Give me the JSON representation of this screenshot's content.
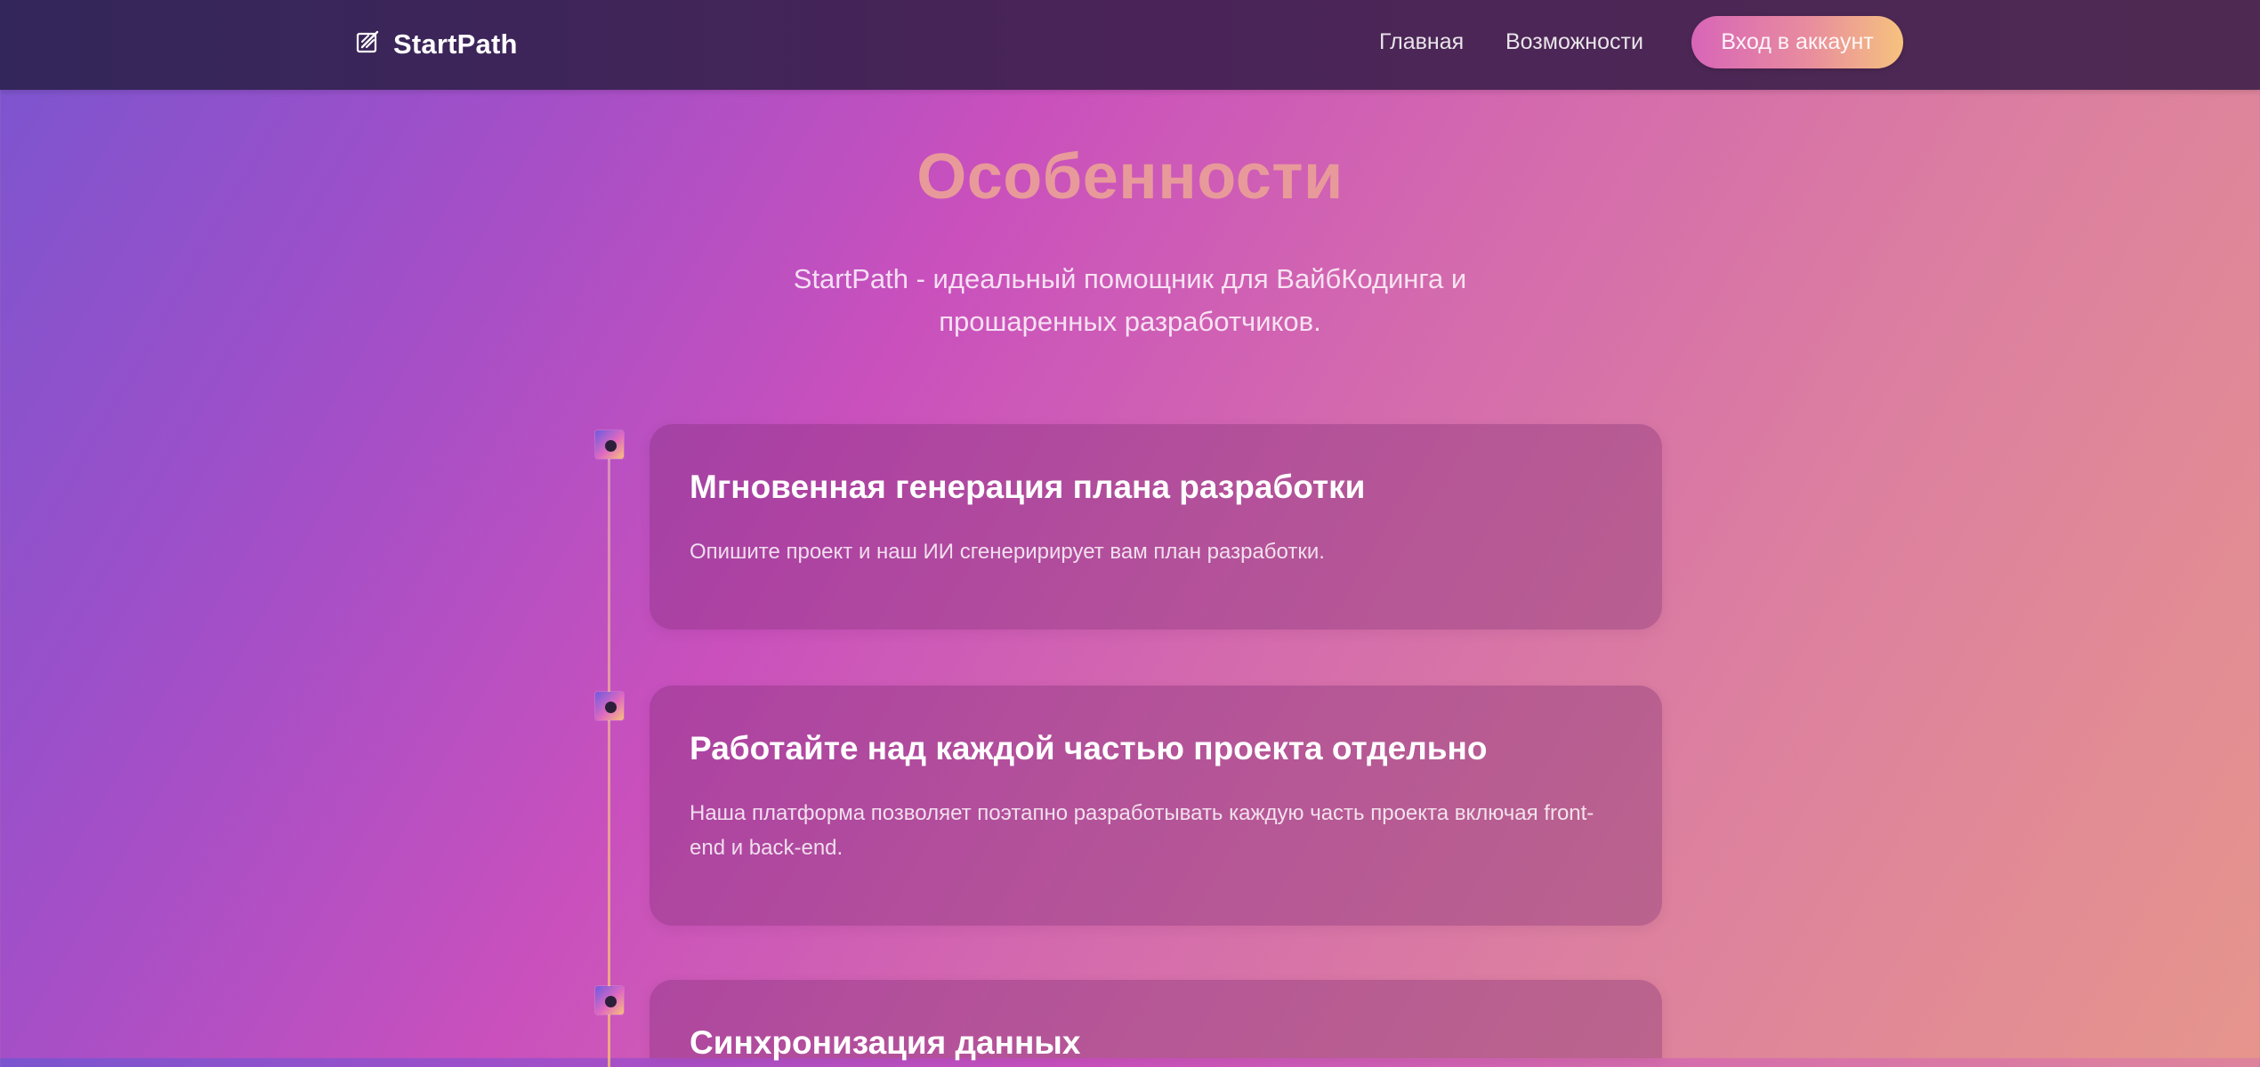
{
  "header": {
    "brand": "StartPath",
    "brand_icon": "pen-square-icon",
    "nav": {
      "home": "Главная",
      "features": "Возможности"
    },
    "login_label": "Вход в аккаунт"
  },
  "hero": {
    "title": "Особенности",
    "subtitle": "StartPath - идеальный помощник для ВайбКодинга и прошаренных разработчиков."
  },
  "features": [
    {
      "title": "Мгновенная генерация плана разработки",
      "text": "Опишите проект и наш ИИ сгенеририрует вам план разработки."
    },
    {
      "title": "Работайте над каждой частью проекта отдельно",
      "text": "Наша платформа позволяет поэтапно разработывать каждую часть проекта включая front-end и back-end."
    },
    {
      "title": "Синхронизация данных",
      "text": ""
    }
  ],
  "colors": {
    "header_bg": "#3a2659",
    "title_accent": "#e89a9a",
    "button_gradient_start": "#d865b8",
    "button_gradient_end": "#f6c27e"
  }
}
